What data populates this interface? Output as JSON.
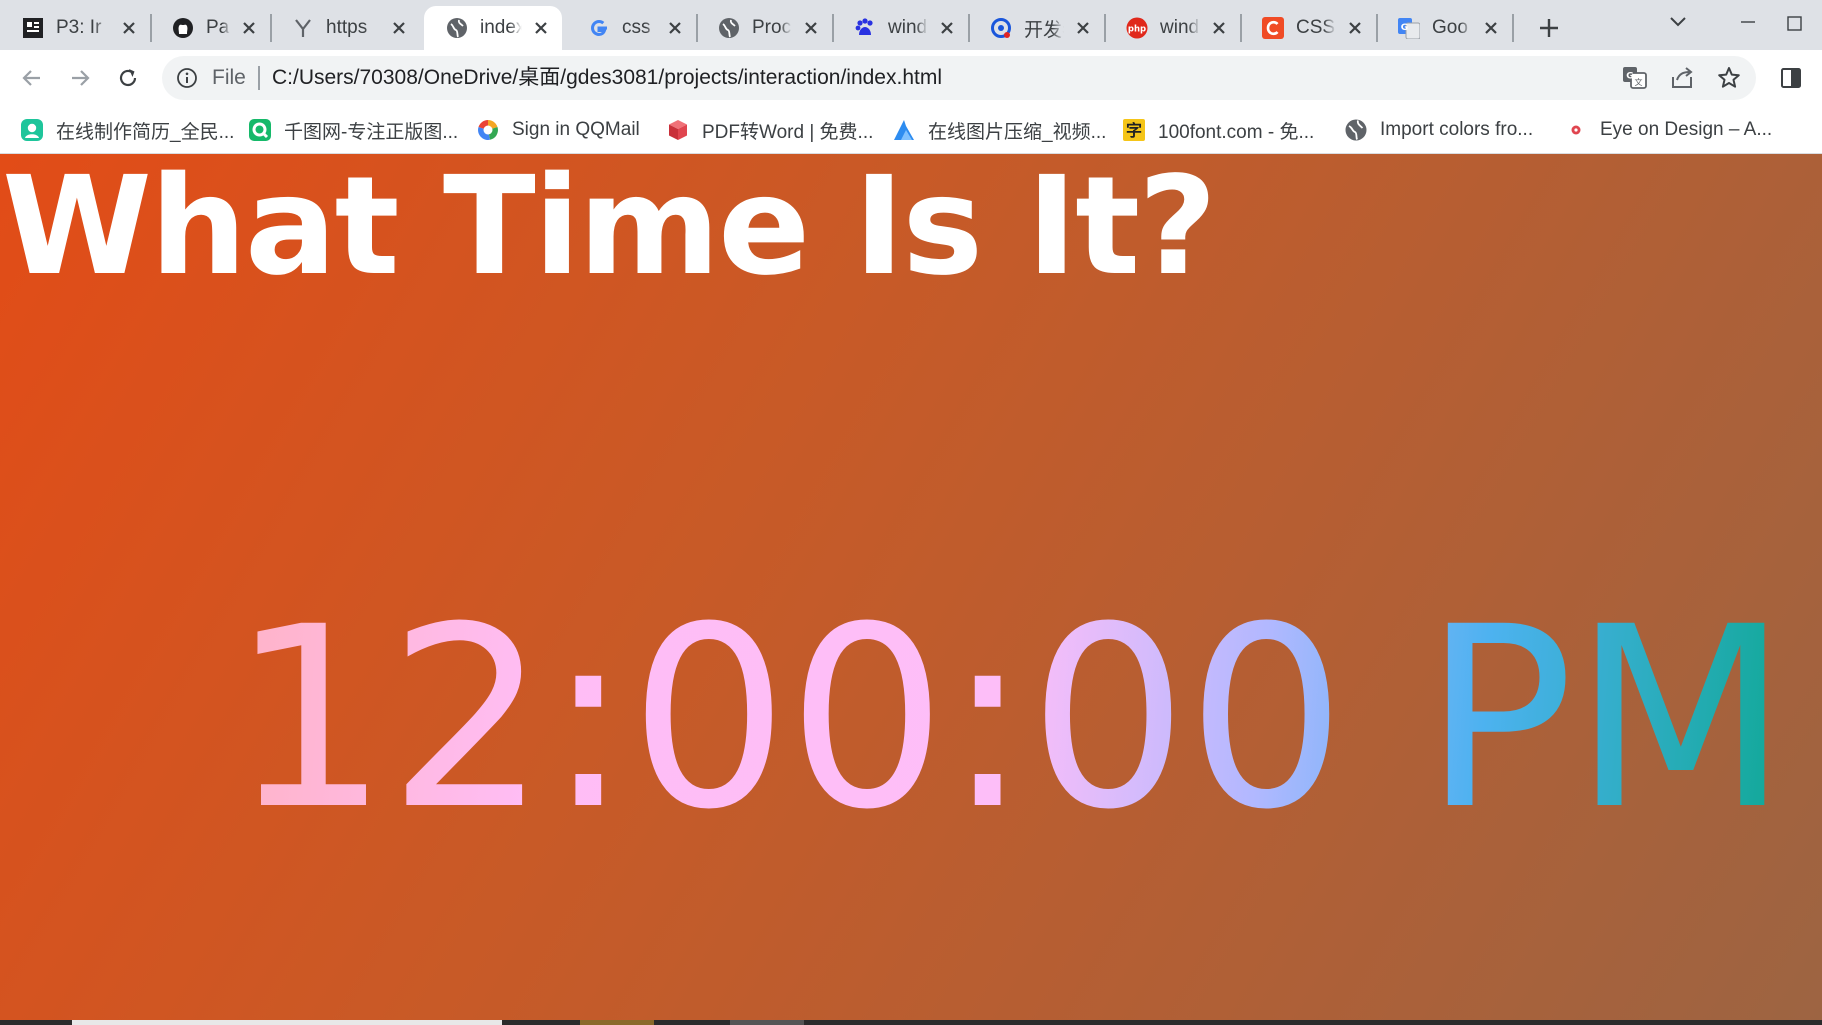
{
  "tabs": [
    {
      "title": "P3: Ir",
      "icon": "app-icon"
    },
    {
      "title": "Page",
      "icon": "github-icon"
    },
    {
      "title": "https",
      "icon": "y-icon"
    },
    {
      "title": "index",
      "icon": "globe-icon",
      "active": true
    },
    {
      "title": "css d",
      "icon": "google-icon"
    },
    {
      "title": "Proc",
      "icon": "globe-icon"
    },
    {
      "title": "wind",
      "icon": "baidu-icon"
    },
    {
      "title": "开发者",
      "icon": "q-icon"
    },
    {
      "title": "wind",
      "icon": "php-icon"
    },
    {
      "title": "CSS F",
      "icon": "c-icon"
    },
    {
      "title": "Goo",
      "icon": "google-translate-icon"
    }
  ],
  "address_bar": {
    "scheme_label": "File",
    "url": "C:/Users/70308/OneDrive/桌面/gdes3081/projects/interaction/index.html"
  },
  "bookmarks": [
    {
      "label": "在线制作简历_全民...",
      "icon": "resume-icon",
      "color": "#1ec59b"
    },
    {
      "label": "千图网-专注正版图...",
      "icon": "qiantu-icon",
      "color": "#16b96a"
    },
    {
      "label": "Sign in QQMail",
      "icon": "qqmail-icon",
      "color": "#f5a623"
    },
    {
      "label": "PDF转Word | 免费...",
      "icon": "pdf-cube-icon",
      "color": "#e0454f"
    },
    {
      "label": "在线图片压缩_视频...",
      "icon": "compress-icon",
      "color": "#2d8cf0"
    },
    {
      "label": "100font.com - 免...",
      "icon": "zi-icon",
      "color": "#f5c518"
    },
    {
      "label": "Import colors fro...",
      "icon": "globe-icon",
      "color": "#5f6368"
    },
    {
      "label": "Eye on Design – A...",
      "icon": "dot-icon",
      "color": "#e0454f"
    }
  ],
  "page": {
    "title": "What Time Is It?",
    "clock_text": "12:00:00 PM"
  },
  "colors": {
    "tabstrip_bg": "#dee1e6",
    "page_gradient_start": "#e24c17",
    "page_gradient_end": "#9d6442",
    "clock_gradient": [
      "#ffb3c6",
      "#fdbef8",
      "#b1b8ff",
      "#4db2f0",
      "#0fa894"
    ]
  }
}
